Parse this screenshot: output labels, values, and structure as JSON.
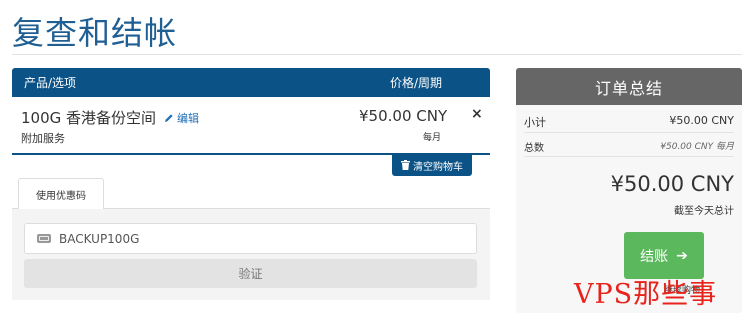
{
  "page": {
    "title": "复查和结帐"
  },
  "cart": {
    "header": {
      "product_label": "产品/选项",
      "price_label": "价格/周期"
    },
    "item": {
      "name": "100G 香港备份空间",
      "edit_label": "编辑",
      "addon_label": "附加服务",
      "price": "¥50.00 CNY",
      "cycle": "每月",
      "remove_symbol": "×"
    },
    "empty_cart_label": "清空购物车"
  },
  "promo": {
    "tab_label": "使用优惠码",
    "input_value": "BACKUP100G",
    "validate_label": "验证"
  },
  "summary": {
    "title": "订单总结",
    "subtotal_label": "小计",
    "subtotal_value": "¥50.00 CNY",
    "total_label": "总数",
    "total_value": "¥50.00 CNY 每月",
    "due_today_amount": "¥50.00 CNY",
    "due_today_label": "截至今天总计",
    "checkout_label": "结账",
    "checkout_arrow": "➔",
    "continue_label": "继续购物"
  },
  "watermark": "VPS那些事",
  "colors": {
    "brand": "#0b5286",
    "title": "#1f5f93",
    "checkout": "#5cb85c",
    "summary_header": "#666666",
    "watermark": "#e8231b"
  }
}
